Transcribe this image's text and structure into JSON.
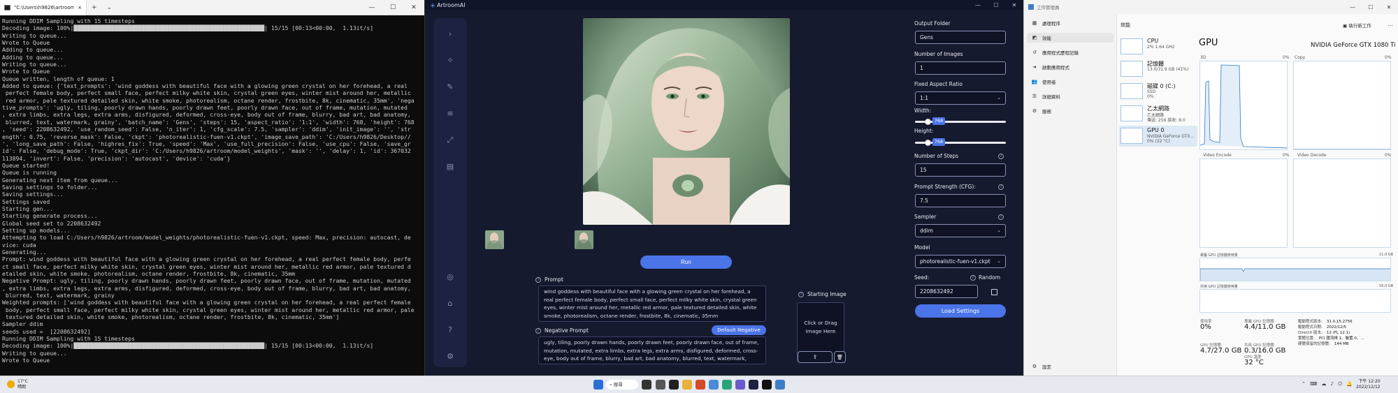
{
  "terminal": {
    "tab_title": "\"C:\\Users\\h9826\\artroom\\mir",
    "controls": {
      "close": "×",
      "new": "+",
      "menu": "⌄"
    },
    "window": {
      "min": "—",
      "max": "☐",
      "close": "✕"
    },
    "lines": [
      "Running DDIM Sampling with 15 timesteps",
      "Decoding image: 100%|████████████████████████████████████████████████████████| 15/15 [00:13<00:00,  1.13it/s]",
      "Writing to queue...",
      "Wrote to Queue",
      "Adding to queue...",
      "Adding to queue...",
      "Writing to queue...",
      "Wrote to Queue",
      "Queue written, length of queue: 1",
      "Added to queue: {'text_prompts': 'wind goddess with beautiful face with a glowing green crystal on her forehead, a real",
      " perfect female body, perfect small face, perfect milky white skin, crystal green eyes, winter mist around her, metallic",
      " red armor, pale textured detailed skin, white smoke, photorealism, octane render, frostbite, 8k, cinematic, 35mm', 'nega",
      "tive_prompts': 'ugly, tiling, poorly drawn hands, poorly drawn feet, poorly drawn face, out of frame, mutation, mutated",
      ", extra limbs, extra legs, extra arms, disfigured, deformed, cross-eye, body out of frame, blurry, bad art, bad anatomy,",
      " blurred, text, watermark, grainy', 'batch_name': 'Gens', 'steps': 15, 'aspect_ratio': '1:1', 'width': 768, 'height': 768",
      ", 'seed': 2208632492, 'use_random_seed': False, 'n_iter': 1, 'cfg_scale': 7.5, 'sampler': 'ddim', 'init_image': '', 'str",
      "ength': 0.75, 'reverse_mask': False, 'ckpt': 'photorealistic-fuen-v1.ckpt', 'image_save_path': 'C:/Users/h9826/Desktop//",
      "', 'long_save_path': False, 'highres_fix': True, 'speed': 'Max', 'use_full_precision': False, 'use_cpu': False, 'save_gr",
      "id': False, 'debug_mode': True, 'ckpt_dir': 'C:/Users/h9826/artroom/model_weights', 'mask': '', 'delay': 1, 'id': 367032",
      "113894, 'invert': False, 'precision': 'autocast', 'device': 'cuda'}",
      "Queue started!",
      "Queue is running",
      "Generating next item from queue...",
      "Saving settings to folder...",
      "Saving settings...",
      "Settings saved",
      "Starting gen...",
      "Starting generate process...",
      "Global seed set to 2208632492",
      "Setting up models...",
      "Attempting to load C:/Users/h9826/artroom/model_weights/photorealistic-fuen-v1.ckpt, speed: Max, precision: autocast, de",
      "vice: cuda",
      "Generating...",
      "Prompt: wind goddess with beautiful face with a glowing green crystal on her forehead, a real perfect female body, perfe",
      "ct small face, perfect milky white skin, crystal green eyes, winter mist around her, metallic red armor, pale textured d",
      "etailed skin, white smoke, photorealism, octane render, frostbite, 8k, cinematic, 35mm",
      "Negative Prompt: ugly, tiling, poorly drawn hands, poorly drawn feet, poorly drawn face, out of frame, mutation, mutated",
      ", extra limbs, extra legs, extra arms, disfigured, deformed, cross-eye, body out of frame, blurry, bad art, bad anatomy,",
      " blurred, text, watermark, grainy",
      "Weighted prompts: ['wind goddess with beautiful face with a glowing green crystal on her forehead, a real perfect female",
      " body, perfect small face, perfect milky white skin, crystal green eyes, winter mist around her, metallic red armor, pale",
      " textured detailed skin, white smoke, photorealism, octane render, frostbite, 8k, cinematic, 35mm']",
      "Sampler ddim",
      "seeds used =  [2208632492]",
      "Running DDIM Sampling with 15 timesteps",
      "Decoding image: 100%|████████████████████████████████████████████████████████| 15/15 [00:13<00:00,  1.13it/s]",
      "Writing to queue...",
      "Wrote to Queue"
    ]
  },
  "artroom": {
    "title": "ArtroomAI",
    "logo": "◈",
    "window": {
      "min": "—",
      "max": "☐",
      "close": "✕"
    },
    "run_label": "Run",
    "prompt_label": "Prompt",
    "prompt": "wind goddess with beautiful face with a glowing green crystal on her forehead, a real perfect female body, perfect small face, perfect milky white skin, crystal green eyes, winter mist around her, metallic red armor, pale textured detailed skin, white smoke, photorealism, octane render, frostbite, 8k, cinematic, 35mm",
    "negative_label": "Negative Prompt",
    "default_negative_label": "Default Negative",
    "negative_prompt": "ugly, tiling, poorly drawn hands, poorly drawn feet, poorly drawn face, out of frame, mutation, mutated, extra limbs, extra legs, extra arms, disfigured, deformed, cross-eye, body out of frame, blurry, bad art, bad anatomy, blurred, text, watermark, grainy",
    "starting_image_label": "Starting Image",
    "starting_image_hint": "Click or Drag Image Here",
    "upload_glyph": "⇪",
    "delete_glyph": "🗑",
    "help_glyph": "?",
    "settings": {
      "output_folder_label": "Output Folder",
      "output_folder": "Gens",
      "num_images_label": "Number of Images",
      "num_images": "1",
      "aspect_label": "Fixed Aspect Ratio",
      "aspect": "1:1",
      "width_label": "Width:",
      "width": "768",
      "height_label": "Height:",
      "height": "768",
      "steps_label": "Number of Steps",
      "steps": "15",
      "cfg_label": "Prompt Strength (CFG):",
      "cfg": "7.5",
      "sampler_label": "Sampler",
      "sampler": "ddim",
      "model_label": "Model",
      "model": "photorealistic-fuen-v1.ckpt",
      "seed_label": "Seed:",
      "seed": "2208632492",
      "random_label": "Random",
      "load_label": "Load Settings"
    }
  },
  "taskmgr": {
    "title": "工作管理員",
    "window": {
      "min": "—",
      "max": "☐",
      "close": "✕"
    },
    "nav": [
      {
        "label": "處理程序",
        "icon": "▦"
      },
      {
        "label": "效能",
        "icon": "◩"
      },
      {
        "label": "應用程式歷程記錄",
        "icon": "↺"
      },
      {
        "label": "啟動應用程式",
        "icon": "➜"
      },
      {
        "label": "使用者",
        "icon": "👥"
      },
      {
        "label": "詳細資料",
        "icon": "☰"
      },
      {
        "label": "服務",
        "icon": "⚙"
      }
    ],
    "settings_label": "設定",
    "header_label": "效能",
    "run_task_label": "執行新工作",
    "more_glyph": "…",
    "devices": [
      {
        "name": "CPU",
        "s1": "2%  1.64 GHz",
        "s2": ""
      },
      {
        "name": "記憶體",
        "s1": "13.0/31.9 GB (41%)",
        "s2": ""
      },
      {
        "name": "磁碟 0 (C:)",
        "s1": "SSD",
        "s2": "0%"
      },
      {
        "name": "乙太網路",
        "s1": "乙太網路",
        "s2": "傳送: 256  接收: 8.0"
      },
      {
        "name": "GPU 0",
        "s1": "NVIDIA GeForce GTX...",
        "s2": "0% (32 °C)"
      }
    ],
    "gpu_title": "GPU",
    "gpu_model": "NVIDIA GeForce GTX 1080 Ti",
    "graph_labels": {
      "g3d": "3D",
      "copy": "Copy",
      "venc": "Video Encode",
      "vdec": "Video Decode",
      "pct0": "0%",
      "dedicated": "專屬 GPU 記憶體使用量",
      "dedicated_max": "11.0 GB",
      "shared": "共用 GPU 記憶體使用量",
      "shared_max": "16.0 GB"
    },
    "stats": [
      {
        "label": "使用率",
        "value": "0%"
      },
      {
        "label": "專屬 GPU 記憶體",
        "value": "4.4/11.0 GB"
      },
      {
        "label": "GPU 記憶體",
        "value": "4.7/27.0 GB"
      },
      {
        "label": "共用 GPU 記憶體",
        "value": "0.3/16.0 GB"
      },
      {
        "label": "GPU 溫度",
        "value": "32 °C"
      }
    ],
    "kv": [
      {
        "k": "驅動程式版本:",
        "v": "31.0.15.2756"
      },
      {
        "k": "驅動程式日期:",
        "v": "2022/12/5"
      },
      {
        "k": "DirectX 版本:",
        "v": "12 (FL 12.1)"
      },
      {
        "k": "實體位置:",
        "v": "PCI 匯流排 1、裝置 0、..."
      },
      {
        "k": "硬體保留的記憶體:",
        "v": "144 MB"
      }
    ]
  },
  "taskbar": {
    "weather_temp": "17°C",
    "weather_desc": "晴朗",
    "search_label": "搜尋",
    "time": "下午 12:20",
    "date": "2022/12/12",
    "tray": "⌃  ⌨  ☁  ♪  ⏻  🔔"
  }
}
